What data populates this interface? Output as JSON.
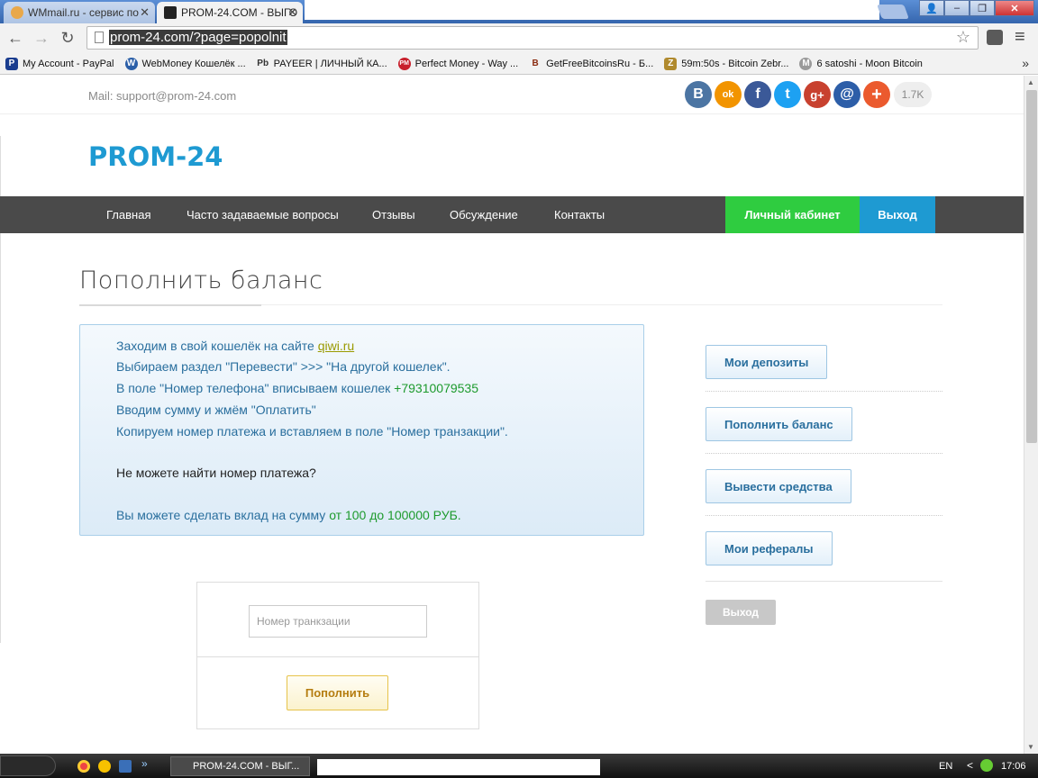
{
  "browser": {
    "tabs": [
      {
        "title": "WMmail.ru - сервис по",
        "state": "inactive"
      },
      {
        "title": "PROM-24.COM - ВЫГО",
        "state": "active"
      }
    ],
    "url": "prom-24.com/?page=popolnit",
    "bookmarks": [
      {
        "label": "My Account - PayPal",
        "color": "#1a3d8f",
        "icon": "P"
      },
      {
        "label": "WebMoney Кошелёк ...",
        "color": "#2b5fa8",
        "icon": "W"
      },
      {
        "label": "PAYEER | ЛИЧНЫЙ КА...",
        "color": "#444444",
        "icon": "Pb"
      },
      {
        "label": "Perfect Money - Way ...",
        "color": "#c8202c",
        "icon": "PM"
      },
      {
        "label": "GetFreeBitcoinsRu - Б...",
        "color": "#8b2b10",
        "icon": "B"
      },
      {
        "label": "59m:50s - Bitcoin Zebr...",
        "color": "#b08a2e",
        "icon": "Z"
      },
      {
        "label": "6 satoshi - Moon Bitcoin",
        "color": "#9a9a9a",
        "icon": "M"
      }
    ],
    "bookmarks_more": "»",
    "window_buttons": [
      "–",
      "❐",
      "✕"
    ]
  },
  "site": {
    "mail": "Mail: support@prom-24.com",
    "social": [
      {
        "icon": "vk-icon",
        "glyph": "B",
        "color": "#4c75a3"
      },
      {
        "icon": "odnoklassniki-icon",
        "glyph": "ok",
        "color": "#f29400"
      },
      {
        "icon": "facebook-icon",
        "glyph": "f",
        "color": "#3b5998"
      },
      {
        "icon": "twitter-icon",
        "glyph": "t",
        "color": "#1da1f2"
      },
      {
        "icon": "google-plus-icon",
        "glyph": "g+",
        "color": "#c8412f"
      },
      {
        "icon": "mail-icon",
        "glyph": "@",
        "color": "#2d5ea8"
      },
      {
        "icon": "more-share-icon",
        "glyph": "+",
        "color": "#eb5a2e"
      }
    ],
    "share_count": "1.7K",
    "logo": "PROM-24",
    "nav": {
      "items": [
        "Главная",
        "Часто задаваемые вопросы",
        "Отзывы",
        "Обсуждение",
        "Контакты"
      ],
      "cabinet": "Личный кабинет",
      "exit": "Выход"
    },
    "page_title": "Пополнить баланс",
    "info": {
      "line1_prefix": "Заходим в свой кошелёк на сайте",
      "line1_link": "qiwi.ru",
      "line2": "Выбираем раздел \"Перевести\" >>> \"На другой кошелек\".",
      "line3_prefix": "В поле \"Номер телефона\" вписываем кошелек",
      "line3_wallet": "+79310079535",
      "line4": "Вводим сумму и жмём \"Оплатить\"",
      "line5": "Копируем номер платежа и вставляем в поле \"Номер транзакции\".",
      "line6": "Не можете найти номер платежа?",
      "line7_prefix": "Вы можете сделать вклад на сумму",
      "line7_range": "от 100 до 100000 РУБ."
    },
    "form": {
      "placeholder": "Номер транкзации",
      "value": "",
      "submit": "Пополнить"
    },
    "sidebar": {
      "items": [
        "Мои депозиты",
        "Пополнить баланс",
        "Вывести средства",
        "Мои рефералы"
      ],
      "exit": "Выход"
    }
  },
  "taskbar": {
    "task_title": "PROM-24.COM - ВЫГ...",
    "lang": "EN",
    "clock": "17:06"
  }
}
